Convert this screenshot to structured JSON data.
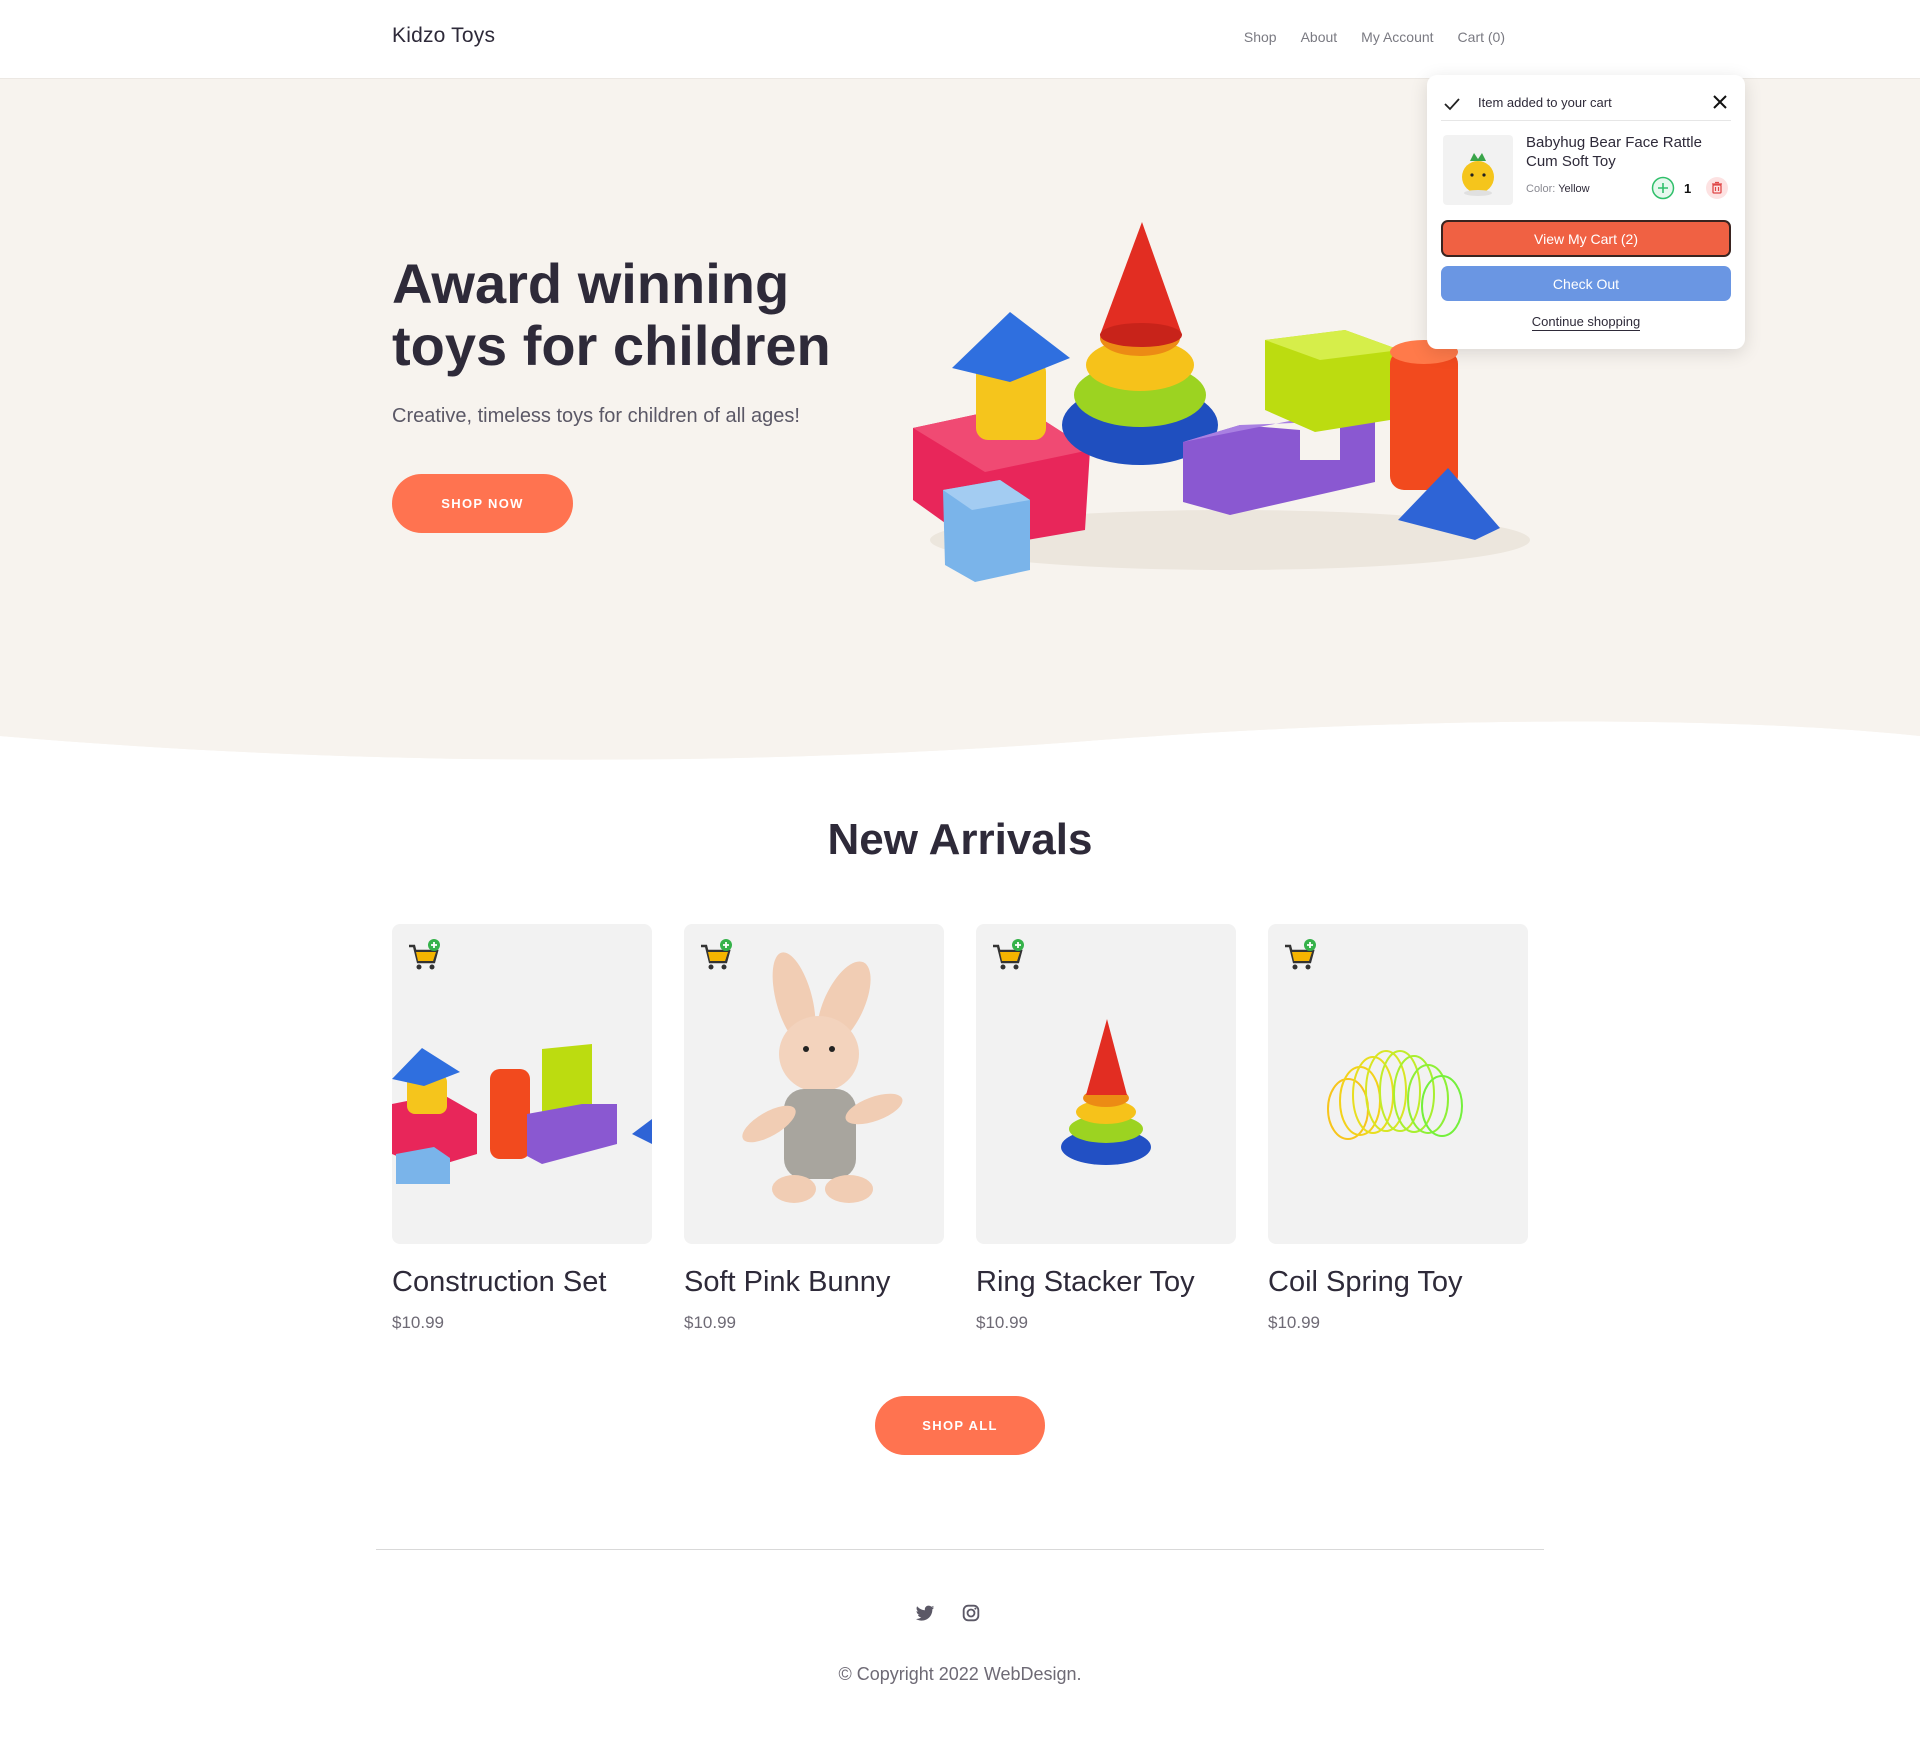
{
  "header": {
    "brand": "Kidzo Toys",
    "nav": [
      "Shop",
      "About",
      "My Account",
      "Cart (0)"
    ]
  },
  "hero": {
    "title": "Award winning toys for children",
    "subtitle": "Creative, timeless toys for children of all ages!",
    "cta": "SHOP NOW"
  },
  "arrivals": {
    "title": "New Arrivals",
    "products": [
      {
        "name": "Construction Set",
        "price": "$10.99"
      },
      {
        "name": "Soft Pink Bunny",
        "price": "$10.99"
      },
      {
        "name": "Ring Stacker Toy",
        "price": "$10.99"
      },
      {
        "name": "Coil Spring Toy",
        "price": "$10.99"
      }
    ],
    "cta": "SHOP ALL"
  },
  "footer": {
    "social": [
      "twitter-icon",
      "instagram-icon"
    ],
    "copyright": "© Copyright 2022 WebDesign."
  },
  "cart_popup": {
    "message": "Item added to your cart",
    "item_name": "Babyhug Bear Face Rattle Cum Soft Toy",
    "color_label": "Color:",
    "color_value": "Yellow",
    "quantity": "1",
    "view_cart": "View My Cart (2)",
    "checkout": "Check Out",
    "continue": "Continue shopping"
  },
  "colors": {
    "accent": "#ff7350",
    "hero_bg": "#f7f3ee",
    "view_cart_bg": "#f06143",
    "checkout_bg": "#6a96e3",
    "text": "#2e2a39"
  }
}
